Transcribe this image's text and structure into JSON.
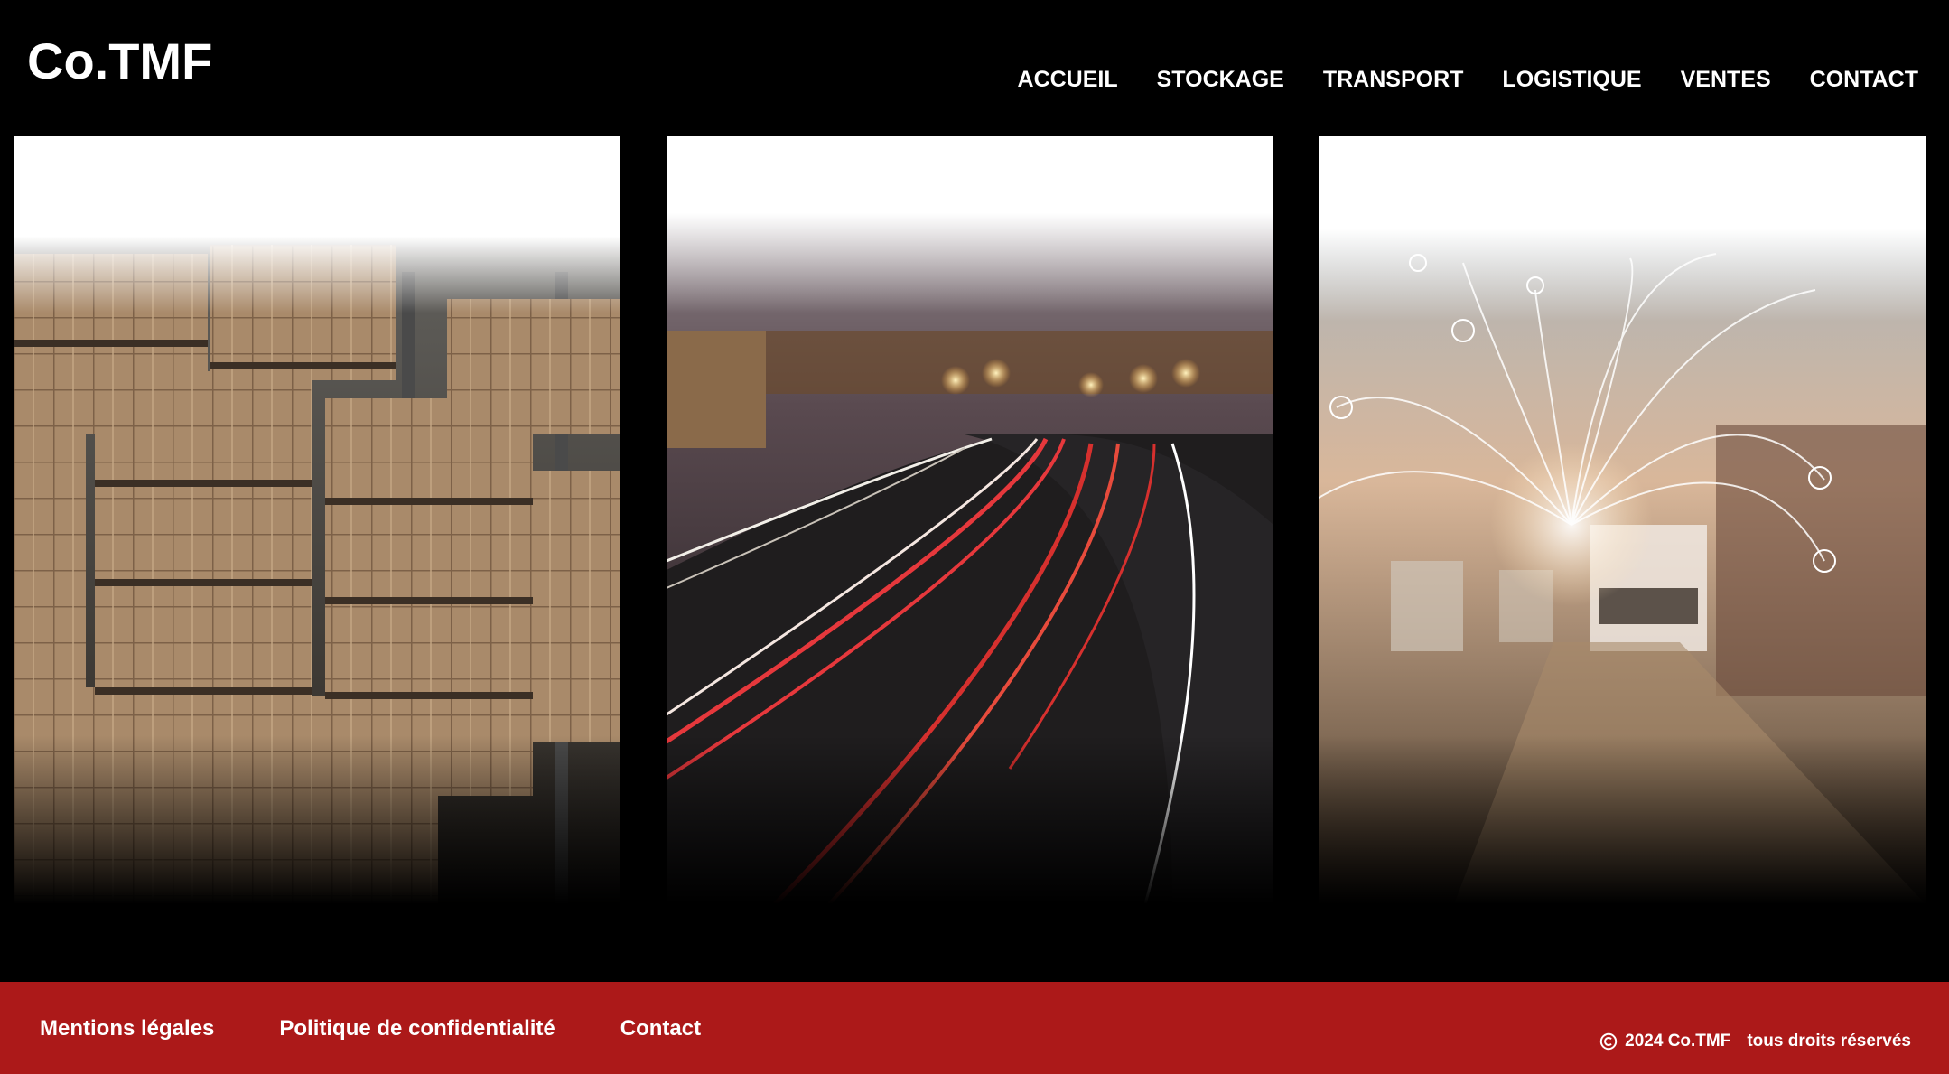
{
  "header": {
    "logo": "Co.TMF",
    "nav": [
      {
        "label": "ACCUEIL"
      },
      {
        "label": "STOCKAGE"
      },
      {
        "label": "TRANSPORT"
      },
      {
        "label": "LOGISTIQUE"
      },
      {
        "label": "VENTES"
      },
      {
        "label": "CONTACT"
      }
    ]
  },
  "panels": [
    {
      "image": "warehouse-cardboard-boxes-image"
    },
    {
      "image": "highway-night-light-trails-image"
    },
    {
      "image": "logistics-network-trucks-image"
    }
  ],
  "footer": {
    "links": [
      {
        "label": "Mentions légales"
      },
      {
        "label": "Politique de confidentialité"
      },
      {
        "label": "Contact"
      }
    ],
    "copyright_year_owner": "2024 Co.TMF",
    "copyright_rights": "tous droits réservés"
  },
  "colors": {
    "background": "#000000",
    "footer": "#ac1919",
    "text": "#ffffff"
  }
}
